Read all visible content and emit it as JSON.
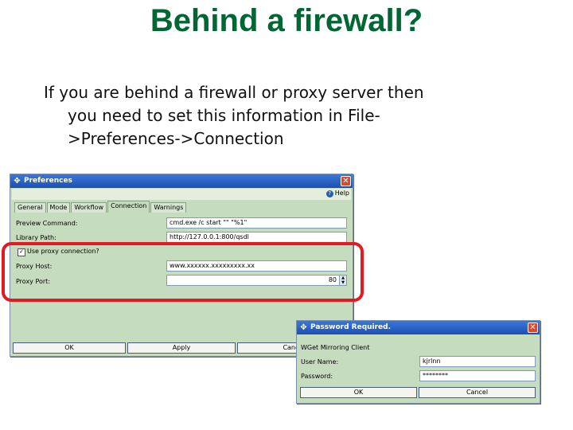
{
  "slide": {
    "title": "Behind a firewall?",
    "line1": "If you are behind a firewall or proxy server then",
    "line2": "you need to set this information in File-",
    "line3": ">Preferences->Connection"
  },
  "preferences_window": {
    "title": "Preferences",
    "menu_help": "Help",
    "tabs": [
      "General",
      "Mode",
      "Workflow",
      "Connection",
      "Warnings"
    ],
    "active_tab": "Connection",
    "preview_command_label": "Preview Command:",
    "preview_command_value": "cmd.exe /c start \"\" \"%1\"",
    "library_path_label": "Library Path:",
    "library_path_value": "http://127.0.0.1:800/qsdl",
    "use_proxy_label": "Use proxy connection?",
    "use_proxy_checked": true,
    "proxy_host_label": "Proxy Host:",
    "proxy_host_value": "www.xxxxxx.xxxxxxxxx.xx",
    "proxy_port_label": "Proxy Port:",
    "proxy_port_value": "80",
    "ok_label": "OK",
    "apply_label": "Apply",
    "cancel_label": "Cancel"
  },
  "password_dialog": {
    "title": "Password Required.",
    "subtitle": "WGet Mirroring Client",
    "user_name_label": "User Name:",
    "user_name_value": "kjrlnn",
    "password_label": "Password:",
    "password_value": "********",
    "ok_label": "OK",
    "cancel_label": "Cancel"
  },
  "colors": {
    "title": "#006633",
    "window_bg": "#c6dcbe",
    "titlebar": "#2660c4",
    "highlight": "#e21a22"
  }
}
